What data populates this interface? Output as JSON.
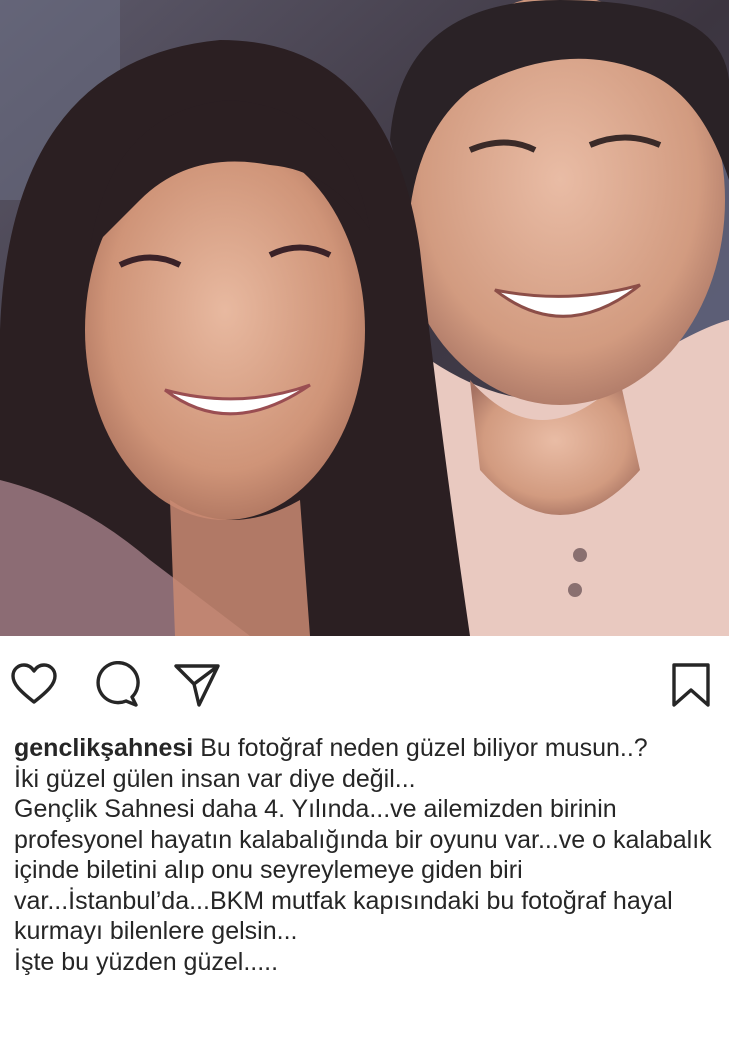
{
  "post": {
    "image_alt": "Selfie of a smiling young woman and young man",
    "caption": {
      "username": "genclikşahnesi",
      "first_text": "Bu fotoğraf neden güzel biliyor musun..?",
      "lines": [
        "İki güzel gülen insan var diye değil...",
        "Gençlik Sahnesi daha 4. Yılında...ve ailemizden birinin profesyonel hayatın kalabalığında bir oyunu var...ve o kalabalık içinde biletini alıp onu seyreylemeye giden biri var...İstanbul’da...BKM mutfak kapısındaki bu fotoğraf hayal kurmayı bilenlere gelsin...",
        "İşte bu yüzden güzel....."
      ]
    }
  },
  "actions": {
    "like_icon": "heart-outline-icon",
    "comment_icon": "comment-bubble-icon",
    "share_icon": "paper-plane-icon",
    "save_icon": "bookmark-icon"
  }
}
